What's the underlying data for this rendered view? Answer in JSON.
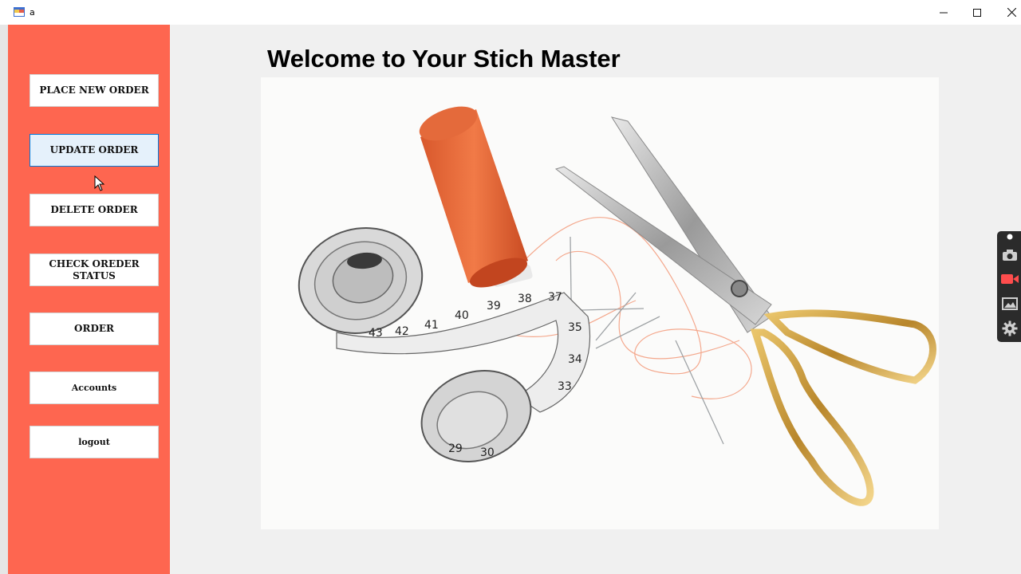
{
  "window": {
    "title": "a",
    "controls": {
      "minimize": "minimize-icon",
      "maximize": "maximize-icon",
      "close": "close-icon"
    }
  },
  "sidebar": {
    "background": "#fe6650",
    "buttons": [
      {
        "label": "PLACE NEW ORDER"
      },
      {
        "label": "UPDATE ORDER"
      },
      {
        "label": "DELETE ORDER"
      },
      {
        "label": "CHECK OREDER STATUS"
      },
      {
        "label": "ORDER"
      },
      {
        "label": "Accounts"
      },
      {
        "label": "logout"
      }
    ]
  },
  "main": {
    "heading": "Welcome to Your Stich Master",
    "image": "sewing-tools-photo",
    "image_subjects": [
      "orange-thread-spool",
      "tape-measure",
      "sewing-needles",
      "gold-handled-scissors"
    ],
    "tape_numbers": [
      "43",
      "42",
      "41",
      "40",
      "39",
      "38",
      "37",
      "35",
      "34",
      "33",
      "29",
      "30"
    ]
  },
  "capture_toolbar": {
    "icons": [
      "pin-icon",
      "camera-icon",
      "video-record-icon",
      "gallery-icon",
      "settings-gear-icon"
    ],
    "record_color": "#ff4d4d"
  }
}
